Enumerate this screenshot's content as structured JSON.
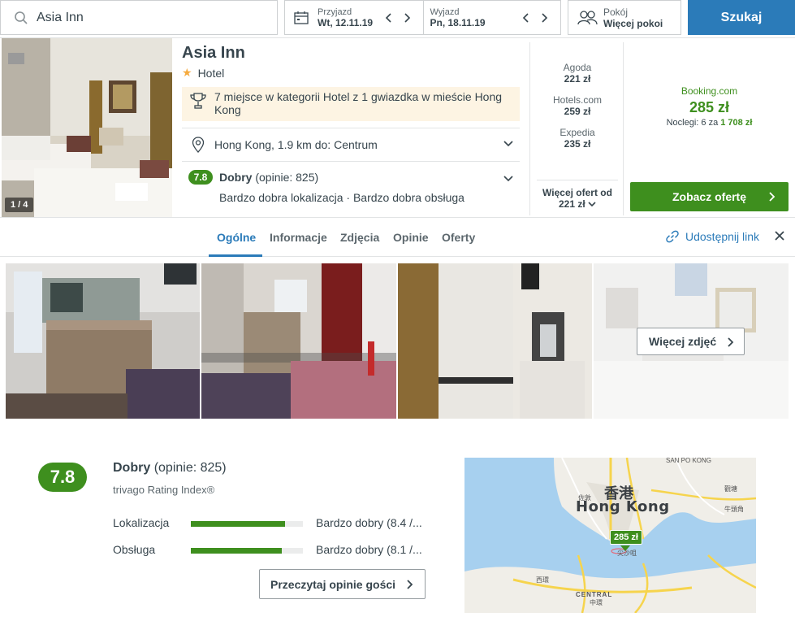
{
  "search": {
    "value": "Asia Inn"
  },
  "dates": {
    "checkin": {
      "label": "Przyjazd",
      "value": "Wt, 12.11.19"
    },
    "checkout": {
      "label": "Wyjazd",
      "value": "Pn, 18.11.19"
    }
  },
  "rooms": {
    "label": "Pokój",
    "value": "Więcej pokoi"
  },
  "search_button": "Szukaj",
  "hotel": {
    "name": "Asia Inn",
    "type": "Hotel",
    "stars": 1,
    "photo_counter": "1 / 4",
    "rank": "7 miejsce w kategorii Hotel z 1 gwiazdka w mieście Hong Kong",
    "location": "Hong Kong, 1.9 km do: Centrum",
    "rating": "7.8",
    "rating_word": "Dobry",
    "rating_count": "(opinie: 825)",
    "rating_sub": "Bardzo dobra lokalizacja · Bardzo dobra obsługa"
  },
  "deals": [
    {
      "name": "Agoda",
      "price": "221 zł"
    },
    {
      "name": "Hotels.com",
      "price": "259 zł"
    },
    {
      "name": "Expedia",
      "price": "235 zł"
    }
  ],
  "more_offers": {
    "label": "Więcej ofert od",
    "price": "221 zł"
  },
  "best_deal": {
    "provider": "Booking.com",
    "price": "285 zł",
    "nights_prefix": "Noclegi: 6 za",
    "nights_total": "1 708 zł",
    "button": "Zobacz ofertę"
  },
  "tabs": [
    "Ogólne",
    "Informacje",
    "Zdjęcia",
    "Opinie",
    "Oferty"
  ],
  "active_tab": "Ogólne",
  "share_label": "Udostępnij link",
  "gallery": {
    "more_photos": "Więcej zdjęć"
  },
  "ratings": {
    "score": "7.8",
    "word": "Dobry",
    "count": "(opinie: 825)",
    "index_label": "trivago Rating Index®",
    "categories": [
      {
        "label": "Lokalizacja",
        "value": "Bardzo dobry (8.4 /...",
        "score": 8.4
      },
      {
        "label": "Obsługa",
        "value": "Bardzo dobry (8.1 /...",
        "score": 8.1
      }
    ],
    "read_button": "Przeczytaj opinie gości"
  },
  "map": {
    "title_cn": "香港",
    "title_en": "Hong Kong",
    "pin_price": "285 zł",
    "labels": [
      "SAN PO KONG",
      "佐敦",
      "牛頭角",
      "觀塘",
      "西環",
      "CENTRAL",
      "中環",
      "尖沙咀"
    ]
  },
  "colors": {
    "accent_blue": "#2b7bb9",
    "deal_green": "#3e8f1e",
    "star": "#f6ab3f"
  }
}
